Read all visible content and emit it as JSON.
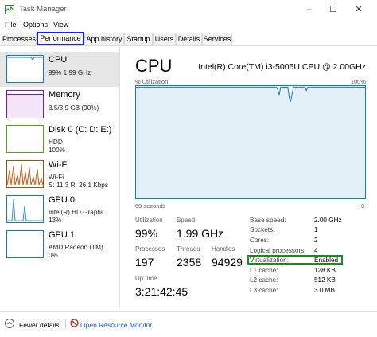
{
  "window": {
    "title": "Task Manager",
    "controls": [
      "–",
      "☐",
      "✕"
    ]
  },
  "menu": [
    "File",
    "Options",
    "View"
  ],
  "tabs": [
    "Processes",
    "Performance",
    "App history",
    "Startup",
    "Users",
    "Details",
    "Services"
  ],
  "active_tab": "Performance",
  "resources": [
    {
      "name": "CPU",
      "lines": [
        "99% 1.99 GHz"
      ],
      "color": "#117dbb"
    },
    {
      "name": "Memory",
      "lines": [
        "3.5/3.9 GB (90%)"
      ],
      "color": "#8b12ae"
    },
    {
      "name": "Disk 0 (C: D: E:)",
      "lines": [
        "HDD",
        "100%"
      ],
      "color": "#4da60c"
    },
    {
      "name": "Wi-Fi",
      "lines": [
        "Wi-Fi",
        "S: 11.3 R: 26.1 Kbps"
      ],
      "color": "#a74f01"
    },
    {
      "name": "GPU 0",
      "lines": [
        "Intel(R) HD Graphi...",
        "13%"
      ],
      "color": "#117dbb"
    },
    {
      "name": "GPU 1",
      "lines": [
        "AMD Radeon (TM)...",
        "0%"
      ],
      "color": "#117dbb"
    }
  ],
  "detail": {
    "title": "CPU",
    "cpu_name": "Intel(R) Core(TM) i3-5005U CPU @ 2.00GHz",
    "graph_top_left": "% Utilization",
    "graph_top_right": "100%",
    "graph_bottom_left": "60 seconds",
    "graph_bottom_right": "0",
    "utilization_percent": [
      99,
      99,
      99,
      99,
      99,
      99,
      99,
      99,
      99,
      99,
      99,
      99,
      99,
      99,
      99,
      99,
      99,
      99,
      99,
      99,
      99,
      99,
      99,
      99,
      99,
      99,
      99,
      99,
      99,
      99,
      99,
      99,
      99,
      99,
      99,
      99,
      99,
      99,
      99,
      99,
      99,
      99,
      99,
      99,
      99,
      99,
      99,
      99,
      99,
      99,
      99,
      99,
      99,
      99,
      99,
      99,
      99,
      99,
      99,
      99,
      99,
      99,
      99,
      99,
      99,
      99,
      99,
      99,
      99,
      99,
      99,
      99,
      99,
      99,
      99,
      99,
      99,
      99,
      99,
      99,
      99,
      99,
      99,
      99,
      99,
      99,
      99,
      99,
      99,
      99,
      99,
      99,
      99,
      99,
      99,
      99,
      99,
      99,
      99,
      97,
      92,
      99,
      99,
      99,
      99,
      99,
      99,
      90,
      86,
      93,
      99,
      99,
      99,
      99,
      99,
      99,
      99,
      99,
      99,
      96,
      99,
      99,
      99,
      99,
      99,
      99,
      99,
      99,
      99,
      99,
      99,
      99,
      99,
      99,
      99,
      99,
      99,
      99,
      99,
      99,
      99,
      99,
      99,
      99,
      99,
      99,
      99,
      99,
      99,
      99,
      99,
      99,
      99,
      99,
      99,
      99,
      99,
      99,
      99,
      99,
      99
    ],
    "stats": {
      "utilization_label": "Utilization",
      "utilization_value": "99%",
      "speed_label": "Speed",
      "speed_value": "1.99 GHz",
      "processes_label": "Processes",
      "processes_value": "197",
      "threads_label": "Threads",
      "threads_value": "2358",
      "handles_label": "Handles",
      "handles_value": "94929",
      "uptime_label": "Up time",
      "uptime_value": "3:21:42:45"
    },
    "info": [
      {
        "label": "Base speed:",
        "value": "2.00 GHz"
      },
      {
        "label": "Sockets:",
        "value": "1"
      },
      {
        "label": "Cores:",
        "value": "2"
      },
      {
        "label": "Logical processors:",
        "value": "4"
      },
      {
        "label": "Virtualization:",
        "value": "Enabled"
      },
      {
        "label": "L1 cache:",
        "value": "128 KB"
      },
      {
        "label": "L2 cache:",
        "value": "512 KB"
      },
      {
        "label": "L3 cache:",
        "value": "3.0 MB"
      }
    ]
  },
  "footer": {
    "fewer_details": "Fewer details",
    "open_resource_monitor": "Open Resource Monitor"
  },
  "colors": {
    "cpu": "#117dbb",
    "highlight_tab": "#1a1aff",
    "highlight_virtualization": "#1a8a1a"
  }
}
